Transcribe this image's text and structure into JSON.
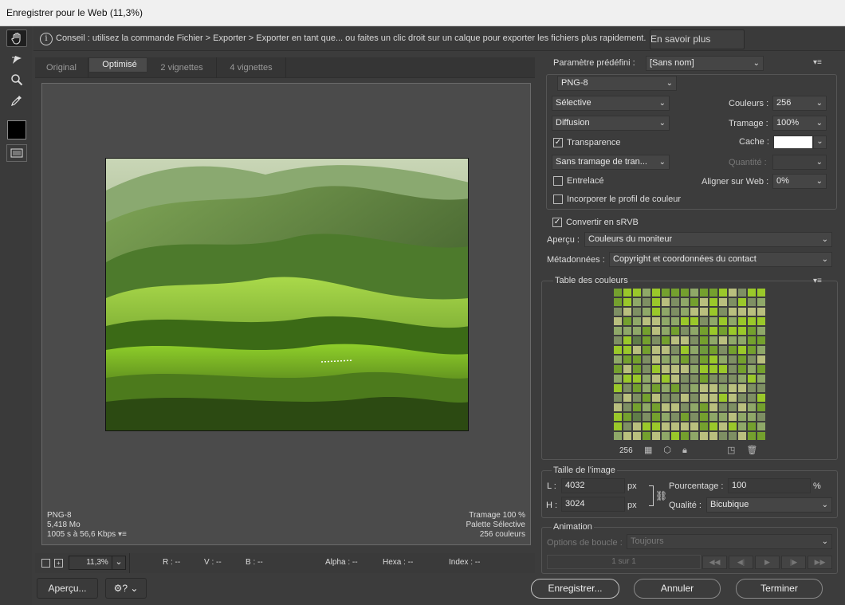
{
  "window": {
    "title": "Enregistrer pour le Web (11,3%)"
  },
  "toolbar": {
    "tools": [
      "hand-icon",
      "slice-select-icon",
      "zoom-icon",
      "eyedropper-icon"
    ]
  },
  "tip": {
    "text": "Conseil : utilisez la commande Fichier > Exporter > Exporter en tant que... ou faites un clic droit sur un calque pour exporter les fichiers plus rapidement.",
    "button": "En savoir plus"
  },
  "tabs": [
    "Original",
    "Optimisé",
    "2 vignettes",
    "4 vignettes"
  ],
  "preview_info": {
    "format": "PNG-8",
    "size": "5,418 Mo",
    "time": "1005 s à 56,6 Kbps",
    "dither": "Tramage 100 %",
    "palette": "Palette Sélective",
    "colors": "256 couleurs"
  },
  "bottom": {
    "zoom": "11,3%",
    "r": "R : --",
    "v": "V : --",
    "b": "B : --",
    "alpha": "Alpha : --",
    "hexa": "Hexa : --",
    "index": "Index : --"
  },
  "settings": {
    "preset_label": "Paramètre prédéfini :",
    "preset": "[Sans nom]",
    "format": "PNG-8",
    "reduction": "Sélective",
    "dither_algo": "Diffusion",
    "colors_label": "Couleurs :",
    "colors": "256",
    "dither_label": "Tramage :",
    "dither": "100%",
    "transparency": "Transparence",
    "matte_label": "Cache :",
    "trans_dither": "Sans tramage de tran...",
    "amount_label": "Quantité :",
    "interlaced": "Entrelacé",
    "websnap_label": "Aligner sur Web :",
    "websnap": "0%",
    "embed_profile": "Incorporer le profil de couleur",
    "srgb": "Convertir en sRVB",
    "preview_label": "Aperçu :",
    "preview": "Couleurs du moniteur",
    "metadata_label": "Métadonnées :",
    "metadata": "Copyright et coordonnées du contact"
  },
  "color_table": {
    "title": "Table des couleurs",
    "count": "256"
  },
  "image_size": {
    "title": "Taille de l'image",
    "w_label": "L :",
    "w": "4032",
    "h_label": "H :",
    "h": "3024",
    "unit": "px",
    "percent_label": "Pourcentage :",
    "percent": "100",
    "percent_unit": "%",
    "quality_label": "Qualité :",
    "quality": "Bicubique"
  },
  "animation": {
    "title": "Animation",
    "loop_label": "Options de boucle :",
    "loop": "Toujours",
    "frame": "1 sur 1"
  },
  "footer": {
    "preview": "Aperçu...",
    "save": "Enregistrer...",
    "cancel": "Annuler",
    "done": "Terminer"
  }
}
